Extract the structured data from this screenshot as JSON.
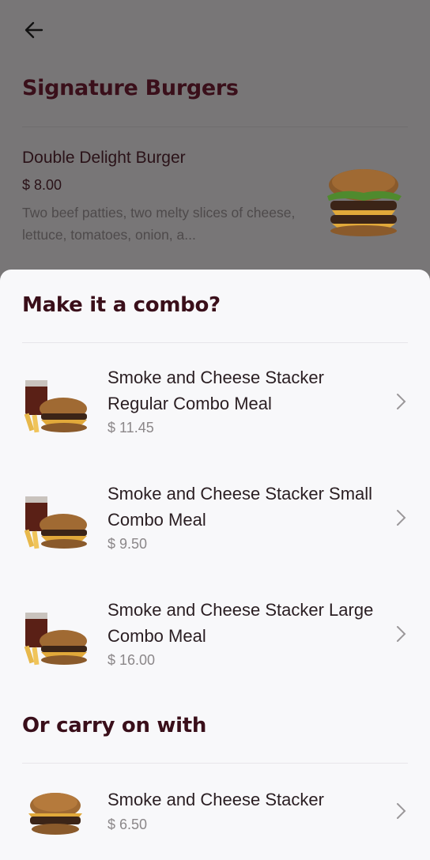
{
  "background": {
    "section_title": "Signature Burgers",
    "item": {
      "name": "Double Delight Burger",
      "price": "$ 8.00",
      "description": "Two beef patties, two melty slices of cheese, lettuce, tomatoes, onion, a...",
      "image_icon": "double-burger-image"
    }
  },
  "sheet": {
    "combo_title": "Make it a combo?",
    "combos": [
      {
        "name": "Smoke and Cheese Stacker Regular Combo Meal",
        "price": "$ 11.45",
        "icon": "combo-meal-image"
      },
      {
        "name": "Smoke and Cheese Stacker Small Combo Meal",
        "price": "$ 9.50",
        "icon": "combo-meal-image"
      },
      {
        "name": "Smoke and Cheese Stacker Large Combo Meal",
        "price": "$ 16.00",
        "icon": "combo-meal-image"
      }
    ],
    "carry_title": "Or carry on with",
    "single": {
      "name": "Smoke and Cheese Stacker",
      "price": "$ 6.50",
      "icon": "burger-image"
    }
  },
  "colors": {
    "heading": "#3a0f1a",
    "price_gray": "#8b8789",
    "overlay": "#787677",
    "sheet_bg": "#f8f8fa"
  }
}
